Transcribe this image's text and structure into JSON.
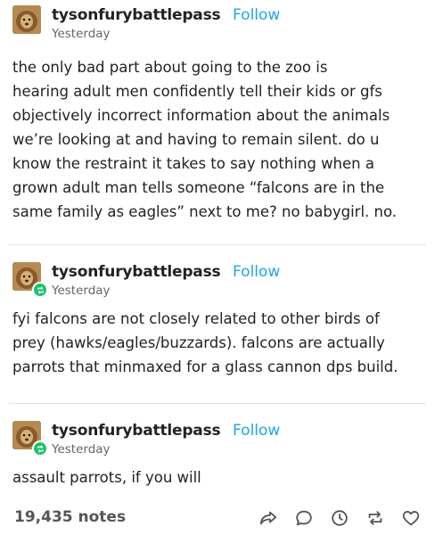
{
  "posts": [
    {
      "username": "tysonfurybattlepass",
      "follow_label": "Follow",
      "timestamp": "Yesterday",
      "lines": [
        "the only bad part about going to the zoo is",
        "hearing adult men confidently tell their kids or gfs",
        "objectively incorrect information about the animals",
        "we’re looking at and having to remain silent. do u",
        "know the restraint it takes to say nothing when a",
        "grown adult man tells someone “falcons are in the",
        "same family as eagles” next to me? no babygirl. no."
      ]
    },
    {
      "username": "tysonfurybattlepass",
      "follow_label": "Follow",
      "timestamp": "Yesterday",
      "lines": [
        "fyi falcons are not closely related to other birds of",
        "prey (hawks/eagles/buzzards). falcons are actually",
        "parrots that minmaxed for a glass cannon dps build."
      ]
    },
    {
      "username": "tysonfurybattlepass",
      "follow_label": "Follow",
      "timestamp": "Yesterday",
      "lines": [
        "assault parrots, if you will"
      ]
    }
  ],
  "footer": {
    "notes": "19,435 notes",
    "icons": [
      "share-icon",
      "comment-icon",
      "clock-icon",
      "reblog-icon",
      "heart-icon"
    ]
  },
  "colors": {
    "follow": "#21a5e6",
    "reblog_badge": "#19c26b",
    "text": "#222222",
    "muted": "#666666"
  }
}
